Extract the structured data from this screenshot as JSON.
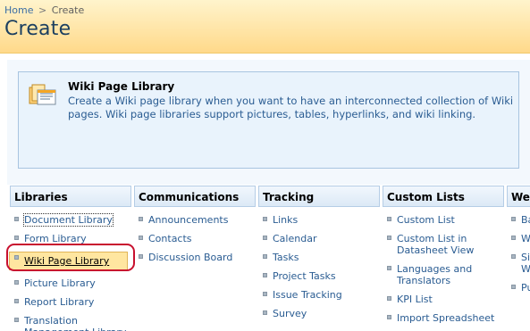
{
  "breadcrumb": {
    "home": "Home",
    "separator": ">",
    "current": "Create"
  },
  "page_title": "Create",
  "description": {
    "title": "Wiki Page Library",
    "text": "Create a Wiki page library when you want to have an interconnected collection of Wiki pages. Wiki page libraries support pictures, tables, hyperlinks, and wiki linking."
  },
  "columns": {
    "libraries": {
      "header": "Libraries",
      "items": [
        "Document Library",
        "Form Library",
        "Wiki Page Library",
        "Picture Library",
        "Report Library",
        "Translation Management Library"
      ]
    },
    "communications": {
      "header": "Communications",
      "items": [
        "Announcements",
        "Contacts",
        "Discussion Board"
      ]
    },
    "tracking": {
      "header": "Tracking",
      "items": [
        "Links",
        "Calendar",
        "Tasks",
        "Project Tasks",
        "Issue Tracking",
        "Survey"
      ]
    },
    "custom_lists": {
      "header": "Custom Lists",
      "items": [
        "Custom List",
        "Custom List in Datasheet View",
        "Languages and Translators",
        "KPI List",
        "Import Spreadsheet"
      ]
    },
    "web_pages": {
      "header": "Web Pages",
      "items": [
        "Basic Page",
        "Web Part Page",
        "Sites and Workspaces",
        "Publishing Page"
      ]
    }
  },
  "colors": {
    "accent": "#c8102e",
    "link": "#2a5c92",
    "header_gradient_bottom": "#ffd98a"
  }
}
